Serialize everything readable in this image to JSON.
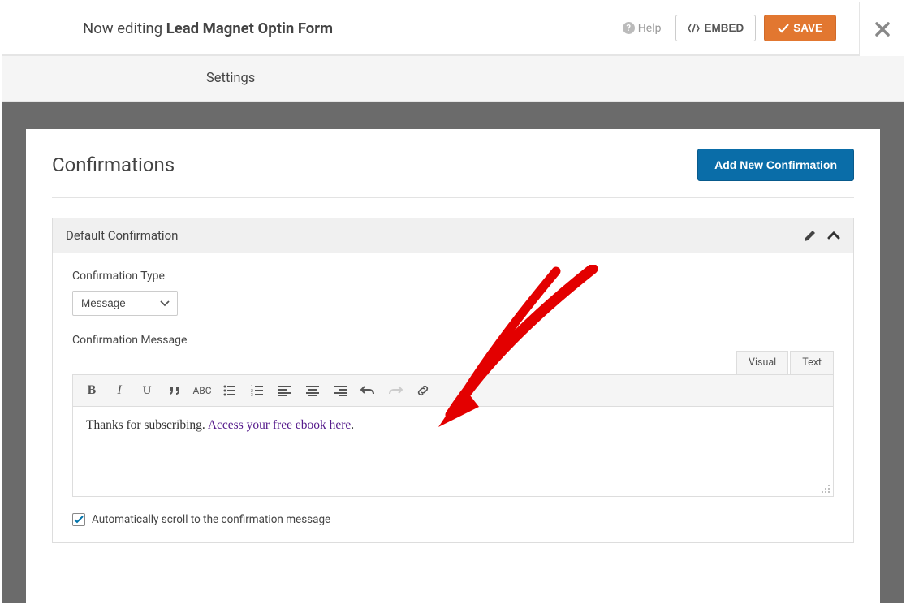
{
  "header": {
    "editing_prefix": "Now editing ",
    "form_name": "Lead Magnet Optin Form",
    "help_label": "Help",
    "embed_label": "EMBED",
    "save_label": "SAVE"
  },
  "nav": {
    "settings_label": "Settings"
  },
  "content": {
    "title": "Confirmations",
    "add_button": "Add New Confirmation"
  },
  "confirmation": {
    "section_title": "Default Confirmation",
    "type_label": "Confirmation Type",
    "type_value": "Message",
    "message_label": "Confirmation Message",
    "message_text_prefix": "Thanks for subscribing. ",
    "message_link_text": "Access your free ebook here",
    "message_text_suffix": ".",
    "tabs": {
      "visual": "Visual",
      "text": "Text"
    },
    "scroll_checkbox_label": "Automatically scroll to the confirmation message",
    "scroll_checked": true
  }
}
